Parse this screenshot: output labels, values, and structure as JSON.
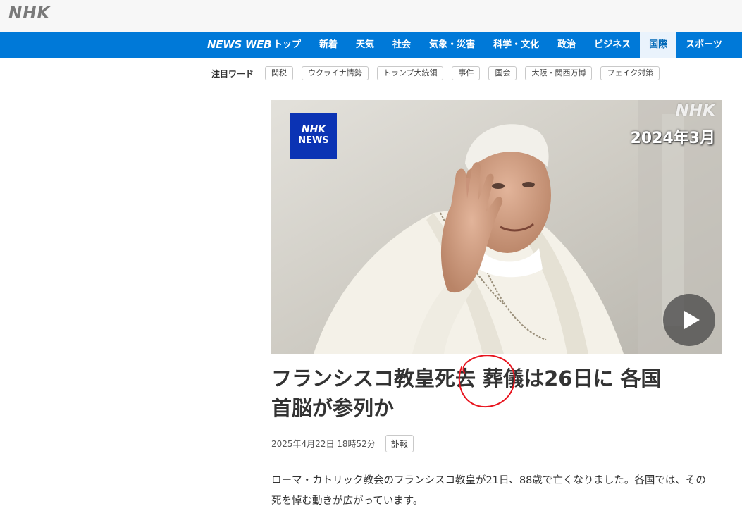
{
  "header": {
    "logo_text": "NHK"
  },
  "nav": {
    "brand": "NEWS WEB",
    "items": [
      {
        "label": "トップ"
      },
      {
        "label": "新着"
      },
      {
        "label": "天気"
      },
      {
        "label": "社会"
      },
      {
        "label": "気象・災害"
      },
      {
        "label": "科学・文化"
      },
      {
        "label": "政治"
      },
      {
        "label": "ビジネス"
      },
      {
        "label": "国際",
        "active": true
      },
      {
        "label": "スポーツ"
      }
    ],
    "colors": {
      "bar": "#0079d8",
      "active_bg": "#eaf3fc",
      "active_text": "#0068b7"
    }
  },
  "keywords": {
    "label": "注目ワード",
    "tags": [
      "関税",
      "ウクライナ情勢",
      "トランプ大統領",
      "事件",
      "国会",
      "大阪・関西万博",
      "フェイク対策"
    ]
  },
  "hero": {
    "badge_line1": "NHK",
    "badge_line2": "NEWS",
    "watermark_logo": "NHK",
    "watermark_date": "2024年3月",
    "play_icon": "play-icon"
  },
  "article": {
    "title_line1": "フランシスコ教皇死去 葬儀は26日に 各国",
    "title_line2": "首脳が参列か",
    "date": "2025年4月22日 18時52分",
    "category": "訃報",
    "summary": "ローマ・カトリック教会のフランシスコ教皇が21日、88歳で亡くなりました。各国では、その死を悼む動きが広がっています。"
  },
  "annotation": {
    "color": "#e8141e"
  }
}
